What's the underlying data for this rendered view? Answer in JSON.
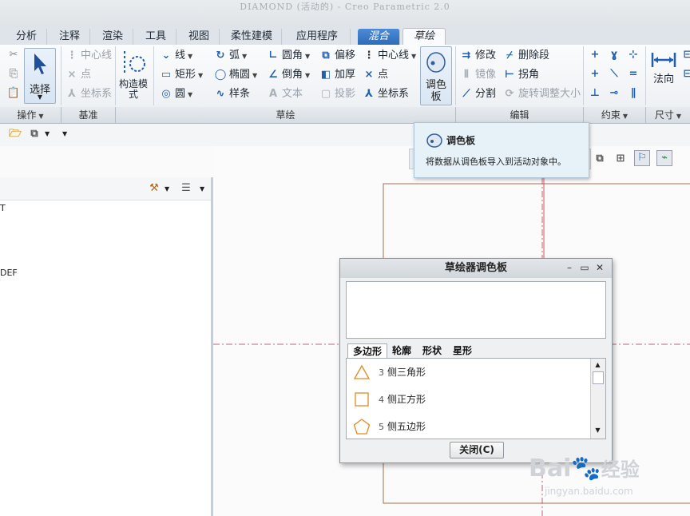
{
  "window": {
    "title": "DIAMOND (活动的) - Creo Parametric 2.0"
  },
  "tabs": [
    {
      "label": "分析"
    },
    {
      "label": "注释"
    },
    {
      "label": "渲染"
    },
    {
      "label": "工具"
    },
    {
      "label": "视图"
    },
    {
      "label": "柔性建模"
    },
    {
      "label": "应用程序"
    },
    {
      "label": "混合"
    },
    {
      "label": "草绘"
    }
  ],
  "ribbon": {
    "operations": {
      "select_label": "选择",
      "group": "操作"
    },
    "datum": {
      "centerline": "中心线",
      "point": "点",
      "csys": "坐标系",
      "group": "基准"
    },
    "construct": {
      "label": "构造模式"
    },
    "sketch": {
      "line": "线",
      "arc": "弧",
      "fillet": "圆角",
      "offset": "偏移",
      "centerline": "中心线",
      "rectangle": "矩形",
      "ellipse": "椭圆",
      "chamfer": "倒角",
      "thicken": "加厚",
      "point": "点",
      "circle": "圆",
      "spline": "样条",
      "text": "文本",
      "project": "投影",
      "csys": "坐标系",
      "palette": "调色板",
      "group": "草绘"
    },
    "edit": {
      "modify": "修改",
      "delete_segment": "删除段",
      "mirror": "镜像",
      "corner": "拐角",
      "divide": "分割",
      "rotate_resize": "旋转调整大小",
      "group": "编辑"
    },
    "constrain": {
      "group": "约束"
    },
    "dimension": {
      "normal": "法向",
      "group": "尺寸"
    }
  },
  "tooltip": {
    "title": "调色板",
    "description": "将数据从调色板导入到活动对象中。"
  },
  "left_panel": {
    "fragments": [
      "T",
      "DEF"
    ]
  },
  "dialog": {
    "title": "草绘器调色板",
    "tabs": [
      {
        "label": "多边形"
      },
      {
        "label": "轮廓"
      },
      {
        "label": "形状"
      },
      {
        "label": "星形"
      }
    ],
    "items": [
      {
        "num": "3",
        "label": "侧三角形"
      },
      {
        "num": "4",
        "label": "侧正方形"
      },
      {
        "num": "5",
        "label": "侧五边形"
      }
    ],
    "close_button": "关闭(C)"
  },
  "watermark": {
    "brand": "Bai",
    "brand2": "经验",
    "url": "jingyan.baidu.com"
  },
  "colors": {
    "shape_orange": "#e38a1c",
    "accent_blue": "#1f5fae",
    "sketch_line": "#a56d54"
  }
}
